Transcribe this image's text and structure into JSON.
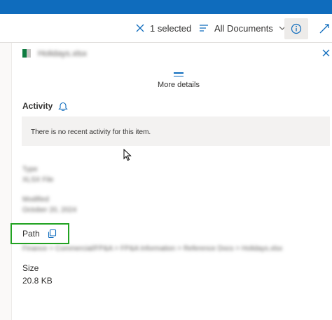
{
  "command_bar": {
    "selected_label": "1 selected",
    "view_label": "All Documents"
  },
  "details_panel": {
    "file_name": "Holidays.xlsx",
    "more_details_label": "More details",
    "activity": {
      "title": "Activity",
      "empty_message": "There is no recent activity for this item."
    },
    "type": {
      "label": "Type",
      "value": "XLSX File"
    },
    "modified": {
      "label": "Modified",
      "value": "October 20, 2024"
    },
    "path": {
      "label": "Path",
      "value": "Finance > Commercial/FP&A > FP&A Information > Reference Docs > Holidays.xlsx"
    },
    "size": {
      "label": "Size",
      "value": "20.8 KB"
    }
  },
  "colors": {
    "brand_blue": "#0f6cbd",
    "highlight_green": "#22a322",
    "excel_green": "#107c41"
  }
}
